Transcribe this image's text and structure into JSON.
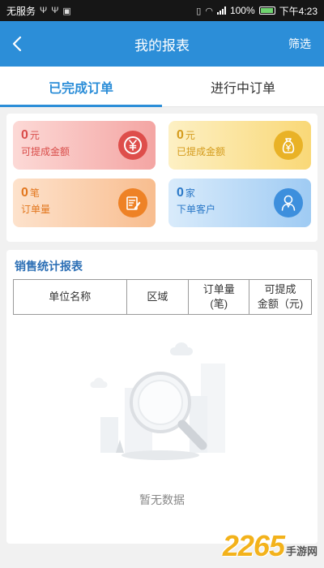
{
  "status_bar": {
    "carrier": "无服务",
    "battery": "100%",
    "time": "下午4:23"
  },
  "header": {
    "title": "我的报表",
    "filter_label": "筛选"
  },
  "tabs": [
    {
      "label": "已完成订单",
      "active": true
    },
    {
      "label": "进行中订单",
      "active": false
    }
  ],
  "stats": [
    {
      "value": "0",
      "unit": "元",
      "label": "可提成金额",
      "icon": "yen-icon"
    },
    {
      "value": "0",
      "unit": "元",
      "label": "已提成金额",
      "icon": "money-bag-icon"
    },
    {
      "value": "0",
      "unit": "笔",
      "label": "订单量",
      "icon": "edit-document-icon"
    },
    {
      "value": "0",
      "unit": "家",
      "label": "下单客户",
      "icon": "customer-icon"
    }
  ],
  "report": {
    "title": "销售统计报表",
    "columns": [
      {
        "line1": "单位名称",
        "line2": ""
      },
      {
        "line1": "区域",
        "line2": ""
      },
      {
        "line1": "订单量",
        "line2": "(笔)"
      },
      {
        "line1": "可提成",
        "line2": "金额（元)"
      }
    ],
    "empty_text": "暂无数据"
  },
  "watermark": {
    "number": "2265",
    "text": "手游网"
  },
  "colors": {
    "primary": "#2c8ed8",
    "report_title": "#2c6fb5"
  }
}
